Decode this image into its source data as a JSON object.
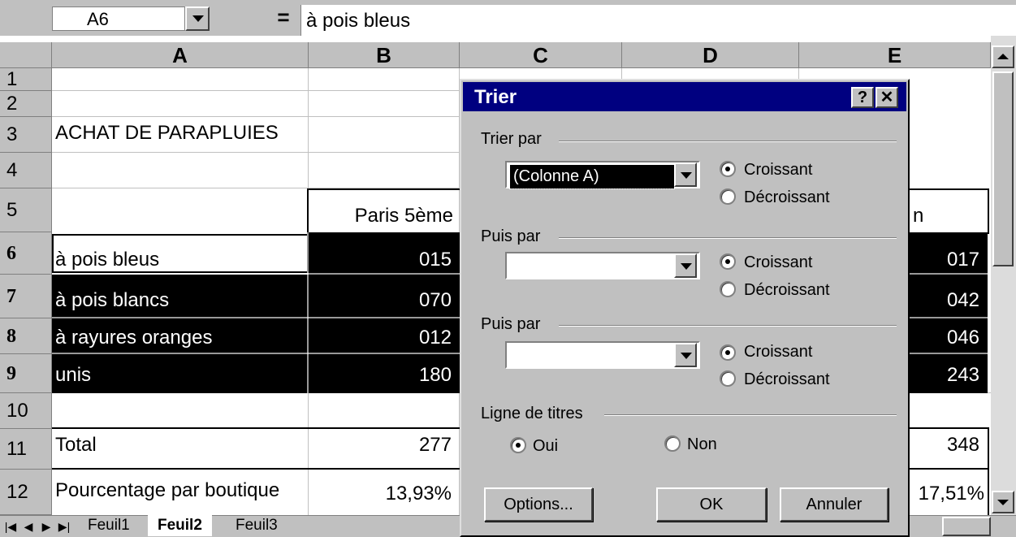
{
  "formula_bar": {
    "name_box": "A6",
    "equals": "=",
    "content": "à pois bleus"
  },
  "columns": [
    "A",
    "B",
    "C",
    "D",
    "E"
  ],
  "rows": [
    "1",
    "2",
    "3",
    "4",
    "5",
    "6",
    "7",
    "8",
    "9",
    "10",
    "11",
    "12"
  ],
  "cells": {
    "title": "ACHAT DE PARAPLUIES",
    "b5": "Paris 5ème",
    "e5_partial": "n",
    "a6": "à pois bleus",
    "b6": "015",
    "e6": "017",
    "a7": "à pois blancs",
    "b7": "070",
    "e7": "042",
    "a8": "à rayures oranges",
    "b8": "012",
    "e8": "046",
    "a9": "unis",
    "b9": "180",
    "e9": "243",
    "a11": "Total",
    "b11": "277",
    "e11": "348",
    "a12": "Pourcentage par boutique",
    "b12": "13,93%",
    "e12": "17,51%"
  },
  "sheet_tabs": [
    "Feuil1",
    "Feuil2",
    "Feuil3"
  ],
  "active_sheet": "Feuil2",
  "dialog": {
    "title": "Trier",
    "help_label": "?",
    "close_label": "✕",
    "sort_by": {
      "label": "Trier par",
      "value": "(Colonne A)",
      "asc": "Croissant",
      "desc": "Décroissant",
      "selected": "asc"
    },
    "then_by_1": {
      "label": "Puis par",
      "value": "",
      "asc": "Croissant",
      "desc": "Décroissant",
      "selected": "asc"
    },
    "then_by_2": {
      "label": "Puis par",
      "value": "",
      "asc": "Croissant",
      "desc": "Décroissant",
      "selected": "asc"
    },
    "header_row": {
      "label": "Ligne de titres",
      "yes": "Oui",
      "no": "Non",
      "selected": "yes"
    },
    "buttons": {
      "options": "Options...",
      "ok": "OK",
      "cancel": "Annuler"
    }
  },
  "colors": {
    "title_bar": "#000080",
    "face": "#c0c0c0",
    "selection": "#000000"
  }
}
